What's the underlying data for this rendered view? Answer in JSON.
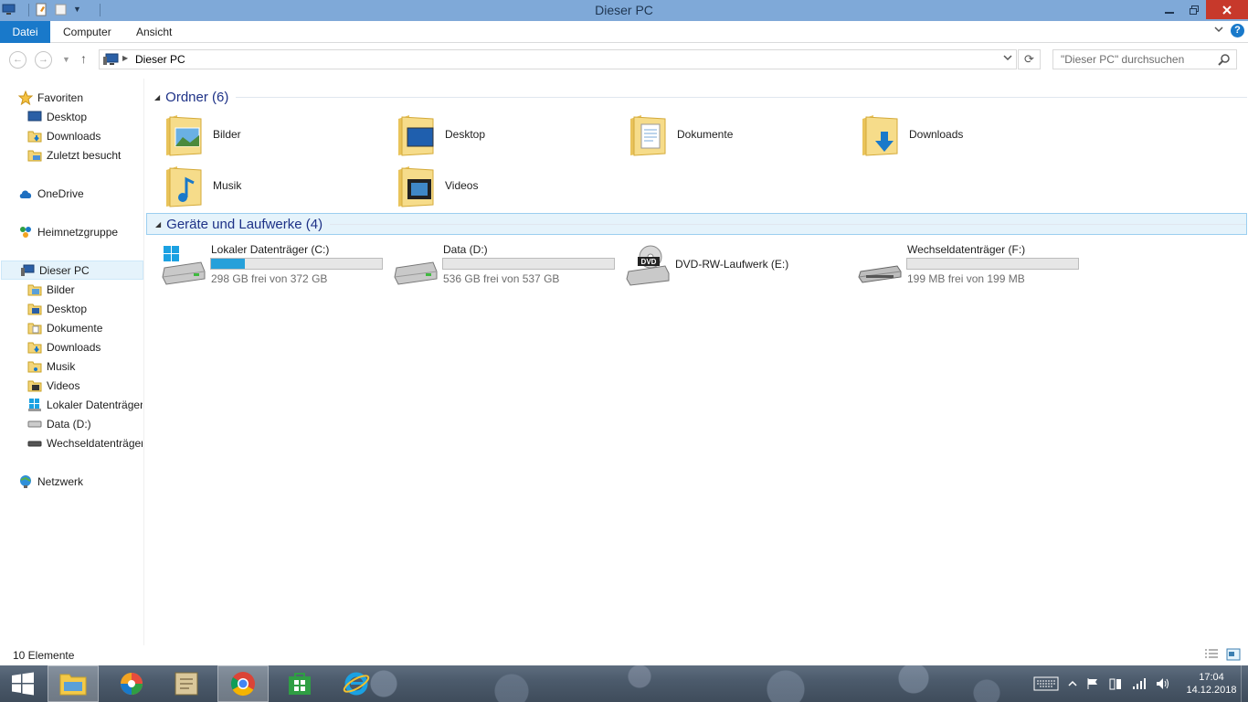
{
  "window": {
    "title": "Dieser PC"
  },
  "ribbon": {
    "tabs": [
      "Datei",
      "Computer",
      "Ansicht"
    ]
  },
  "address": {
    "breadcrumb": "Dieser PC",
    "search_placeholder": "\"Dieser PC\" durchsuchen"
  },
  "sidebar": {
    "favorites": {
      "label": "Favoriten",
      "items": [
        "Desktop",
        "Downloads",
        "Zuletzt besucht"
      ]
    },
    "onedrive": "OneDrive",
    "homegroup": "Heimnetzgruppe",
    "thispc": {
      "label": "Dieser PC",
      "items": [
        "Bilder",
        "Desktop",
        "Dokumente",
        "Downloads",
        "Musik",
        "Videos",
        "Lokaler Datenträger",
        "Data (D:)",
        "Wechseldatenträger"
      ]
    },
    "network": "Netzwerk"
  },
  "content": {
    "folders_header": "Ordner (6)",
    "folders": [
      "Bilder",
      "Desktop",
      "Dokumente",
      "Downloads",
      "Musik",
      "Videos"
    ],
    "drives_header": "Geräte und Laufwerke (4)",
    "drives": [
      {
        "name": "Lokaler Datenträger (C:)",
        "free": "298 GB frei von 372 GB",
        "used_fraction": 0.2
      },
      {
        "name": "Data (D:)",
        "free": "536 GB frei von 537 GB",
        "used_fraction": 0.0
      },
      {
        "name": "DVD-RW-Laufwerk (E:)",
        "free": "",
        "used_fraction": null
      },
      {
        "name": "Wechseldatenträger (F:)",
        "free": "199 MB frei von 199 MB",
        "used_fraction": 0.0
      }
    ]
  },
  "status": {
    "count": "10 Elemente"
  },
  "taskbar": {
    "time": "17:04",
    "date": "14.12.2018"
  },
  "colors": {
    "accent": "#1979ca",
    "titlebar": "#7fa9d8",
    "close": "#c7392b",
    "group_header": "#1e3287",
    "progress": "#26a0da"
  }
}
